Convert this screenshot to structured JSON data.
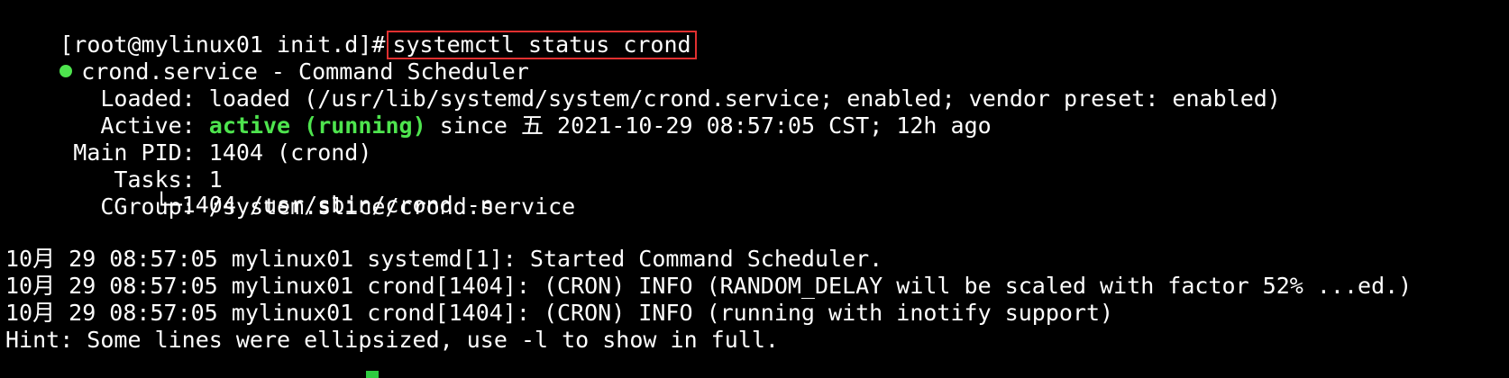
{
  "terminal": {
    "prompt": "[root@mylinux01 init.d]#",
    "command": "systemctl status crond",
    "service_line": "crond.service - Command Scheduler",
    "loaded": {
      "label": "   Loaded:",
      "value": "loaded (/usr/lib/systemd/system/crond.service; enabled; vendor preset: enabled)"
    },
    "active": {
      "label": "   Active:",
      "status": "active (running)",
      "since": "since 五 2021-10-29 08:57:05 CST; 12h ago"
    },
    "main_pid": {
      "label": " Main PID:",
      "value": "1404 (crond)"
    },
    "tasks": {
      "label": "    Tasks:",
      "value": "1"
    },
    "cgroup": {
      "label": "   CGroup:",
      "value": "/system.slice/crond.service"
    },
    "cgroup_child": "           └─1404 /usr/sbin/crond -n",
    "log_lines": [
      "10月 29 08:57:05 mylinux01 systemd[1]: Started Command Scheduler.",
      "10月 29 08:57:05 mylinux01 crond[1404]: (CRON) INFO (RANDOM_DELAY will be scaled with factor 52% ...ed.)",
      "10月 29 08:57:05 mylinux01 crond[1404]: (CRON) INFO (running with inotify support)"
    ],
    "hint": "Hint: Some lines were ellipsized, use -l to show in full.",
    "colors": {
      "background": "#000000",
      "text": "#ffffff",
      "active_green": "#4ee44e",
      "highlight_box": "#e03030"
    }
  }
}
